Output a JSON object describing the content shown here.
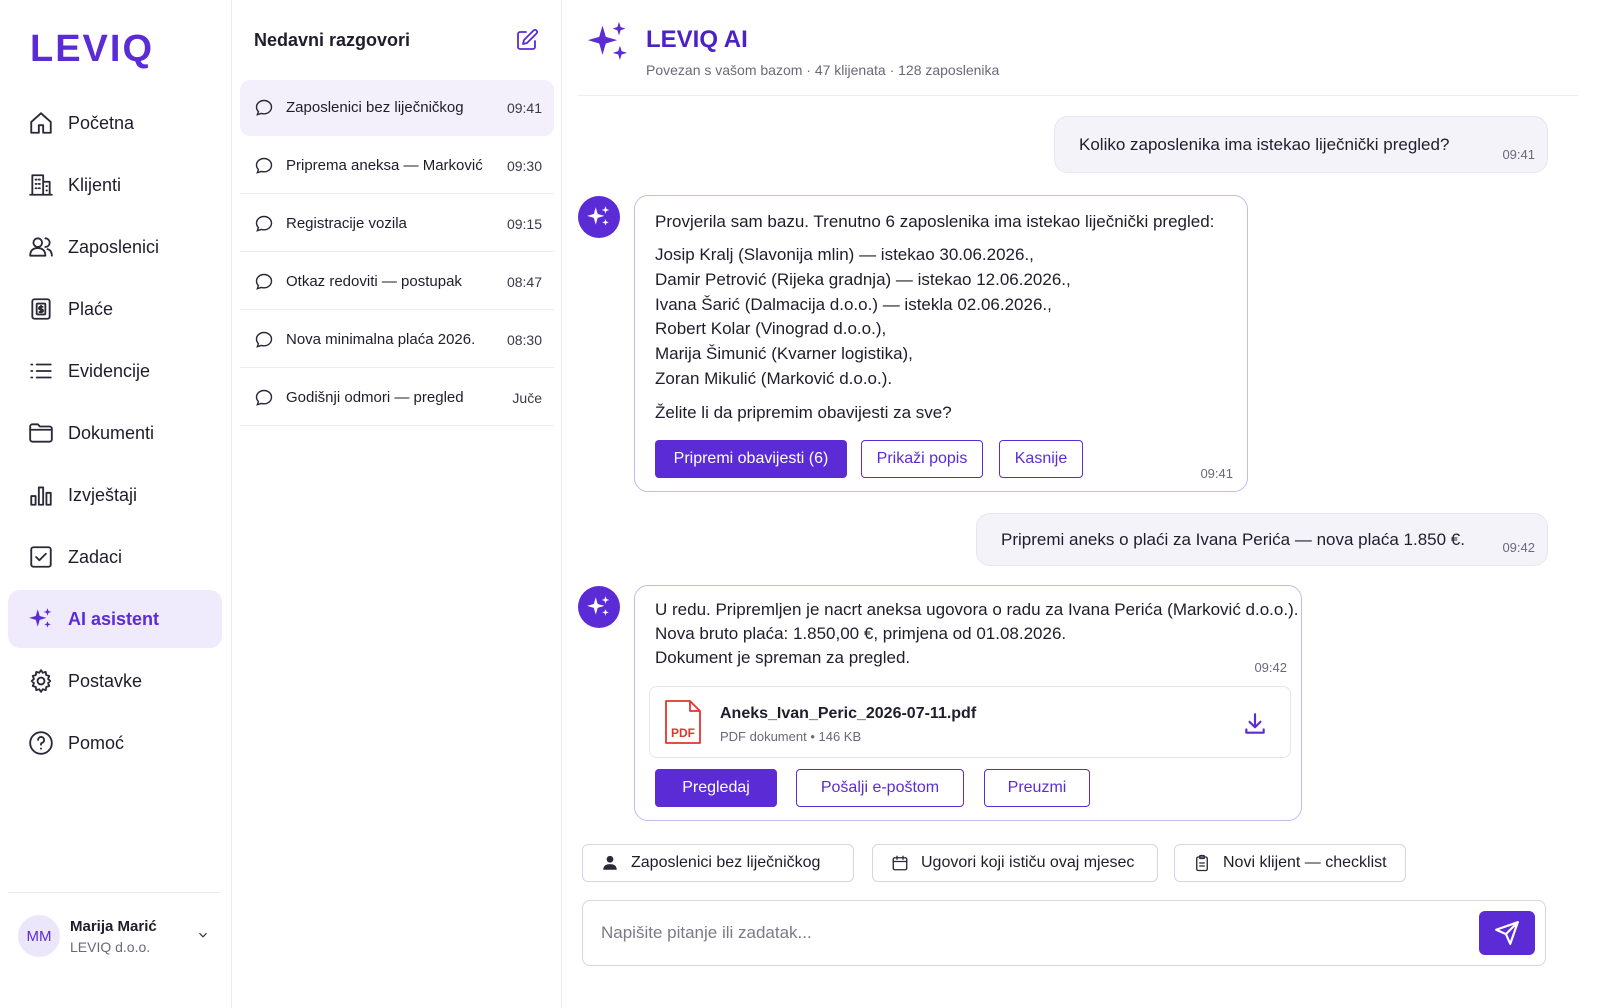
{
  "brand": {
    "logo": "LEVIQ",
    "accent": "#5b2bd6"
  },
  "sidebar": {
    "items": [
      {
        "label": "Početna",
        "icon": "home-icon"
      },
      {
        "label": "Klijenti",
        "icon": "building-icon"
      },
      {
        "label": "Zaposlenici",
        "icon": "users-icon"
      },
      {
        "label": "Plaće",
        "icon": "payslip-icon"
      },
      {
        "label": "Evidencije",
        "icon": "list-icon"
      },
      {
        "label": "Dokumenti",
        "icon": "folder-icon"
      },
      {
        "label": "Izvještaji",
        "icon": "bar-chart-icon"
      },
      {
        "label": "Zadaci",
        "icon": "checkbox-icon"
      },
      {
        "label": "AI asistent",
        "icon": "sparkle-icon",
        "active": true
      },
      {
        "label": "Postavke",
        "icon": "gear-icon"
      },
      {
        "label": "Pomoć",
        "icon": "help-icon"
      }
    ],
    "user": {
      "initials": "MM",
      "name": "Marija Marić",
      "org": "LEVIQ d.o.o."
    }
  },
  "conversations": {
    "title": "Nedavni razgovori",
    "items": [
      {
        "label": "Zaposlenici bez liječničkog",
        "time": "09:41",
        "active": true
      },
      {
        "label": "Priprema aneksa — Marković",
        "time": "09:30"
      },
      {
        "label": "Registracije vozila",
        "time": "09:15"
      },
      {
        "label": "Otkaz redoviti — postupak",
        "time": "08:47"
      },
      {
        "label": "Nova minimalna plaća 2026.",
        "time": "08:30"
      },
      {
        "label": "Godišnji odmori — pregled",
        "time": "Juče"
      }
    ]
  },
  "chat": {
    "title": "LEVIQ AI",
    "subtitle": "Povezan s vašom bazom · 47 klijenata · 128 zaposlenika",
    "messages": [
      {
        "text": "Koliko zaposlenika ima istekao liječnički pregled?",
        "time": "09:41"
      },
      {
        "intro": "Provjerila sam bazu. Trenutno 6 zaposlenika ima istekao liječnički pregled:",
        "lines": [
          "Josip Kralj (Slavonija mlin) — istekao 30.06.2026.,",
          "Damir Petrović (Rijeka gradnja) — istekao 12.06.2026.,",
          "Ivana Šarić (Dalmacija d.o.o.) — istekla 02.06.2026.,",
          "Robert Kolar (Vinograd d.o.o.),",
          "Marija Šimunić (Kvarner logistika),",
          "Zoran Mikulić (Marković d.o.o.)."
        ],
        "question": "Želite li da pripremim obavijesti za sve?",
        "actions": [
          "Pripremi obavijesti (6)",
          "Prikaži popis",
          "Kasnije"
        ],
        "time": "09:41"
      },
      {
        "text": "Pripremi aneks o plaći za Ivana Perića — nova plaća 1.850 €.",
        "time": "09:42"
      },
      {
        "lines": [
          "U redu. Pripremljen je nacrt aneksa ugovora o radu za Ivana Perića (Marković d.o.o.).",
          "Nova bruto plaća: 1.850,00 €, primjena od 01.08.2026.",
          "Dokument je spreman za pregled."
        ],
        "time": "09:42",
        "file": {
          "badge": "PDF",
          "name": "Aneks_Ivan_Peric_2026-07-11.pdf",
          "meta": "PDF dokument • 146 KB"
        },
        "actions": [
          "Pregledaj",
          "Pošalji e-poštom",
          "Preuzmi"
        ]
      }
    ],
    "suggestions": [
      "Zaposlenici bez liječničkog",
      "Ugovori koji ističu ovaj mjesec",
      "Novi klijent — checklist"
    ],
    "input_placeholder": "Napišite pitanje ili zadatak..."
  }
}
